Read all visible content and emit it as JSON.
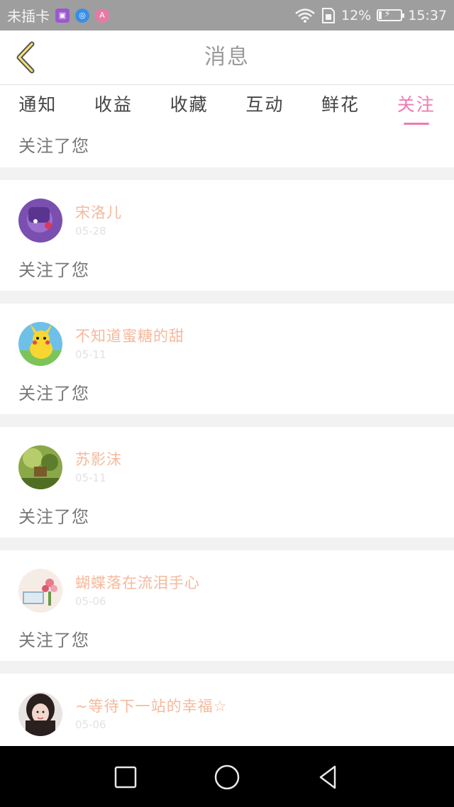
{
  "status": {
    "carrier": "未插卡",
    "battery": "12%",
    "time": "15:37"
  },
  "header": {
    "title": "消息"
  },
  "tabs": [
    {
      "label": "通知"
    },
    {
      "label": "收益"
    },
    {
      "label": "收藏"
    },
    {
      "label": "互动"
    },
    {
      "label": "鲜花"
    },
    {
      "label": "关注",
      "active": true
    }
  ],
  "partial": {
    "action": "关注了您"
  },
  "items": [
    {
      "name": "宋洛儿",
      "date": "05-28",
      "action": "关注了您"
    },
    {
      "name": "不知道蜜糖的甜",
      "date": "05-11",
      "action": "关注了您"
    },
    {
      "name": "苏影沫",
      "date": "05-11",
      "action": "关注了您"
    },
    {
      "name": "蝴蝶落在流泪手心",
      "date": "05-06",
      "action": "关注了您"
    },
    {
      "name": "~等待下一站的幸福☆",
      "date": "05-06"
    }
  ],
  "colors": {
    "accent": "#f07ab0",
    "username": "#f5b99c"
  },
  "icons": {
    "back": "back-chevron-icon",
    "home": "home-circle-icon",
    "recents": "recents-square-icon",
    "nav_back": "back-triangle-icon"
  }
}
